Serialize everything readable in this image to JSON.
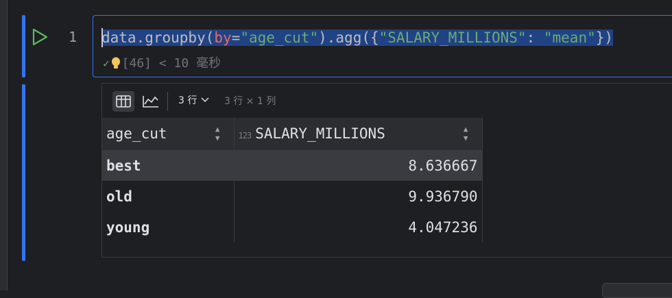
{
  "cell": {
    "line_number": "1",
    "code": {
      "part1": "data.groupby(",
      "kw_arg": "by",
      "part2": "=",
      "str1": "\"age_cut\"",
      "part3": ").agg({",
      "str2": "\"SALARY_MILLIONS\"",
      "part4": ": ",
      "str3": "\"mean\"",
      "part5": "})"
    },
    "status_text": "[46] < 10 毫秒"
  },
  "output": {
    "rows_select_label": "3 行",
    "shape_text": "3 行 × 1 列",
    "column_type_icon": "123",
    "headers": {
      "index": "age_cut",
      "col1": "SALARY_MILLIONS"
    },
    "rows": [
      {
        "index": "best",
        "value": "8.636667"
      },
      {
        "index": "old",
        "value": "9.936790"
      },
      {
        "index": "young",
        "value": "4.047236"
      }
    ]
  },
  "colors": {
    "accent": "#3574f0",
    "run": "#5fb865",
    "string": "#6aab73",
    "keyword_arg": "#e36b6b"
  }
}
